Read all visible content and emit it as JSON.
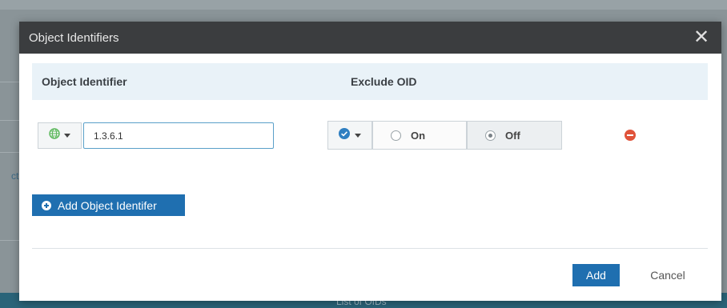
{
  "background": {
    "footer_label": "List of OIDs"
  },
  "dialog": {
    "title": "Object Identifiers",
    "close_glyph": "✕",
    "columns": {
      "object_identifier": "Object Identifier",
      "exclude_oid": "Exclude OID"
    },
    "rows": [
      {
        "type_icon": "globe-icon",
        "oid_value": "1.3.6.1",
        "exclude_icon": "check-circle-icon",
        "exclude_options": [
          "On",
          "Off"
        ],
        "exclude_selected": "Off"
      }
    ],
    "add_identifier_label": "Add Object Identifer",
    "footer": {
      "add_label": "Add",
      "cancel_label": "Cancel"
    }
  },
  "colors": {
    "header_bg": "#3b3d3f",
    "column_header_bg": "#e9f2f8",
    "primary": "#1f6fb0",
    "remove": "#e0533a",
    "globe": "#5cb85c",
    "check": "#2f7fc1"
  }
}
